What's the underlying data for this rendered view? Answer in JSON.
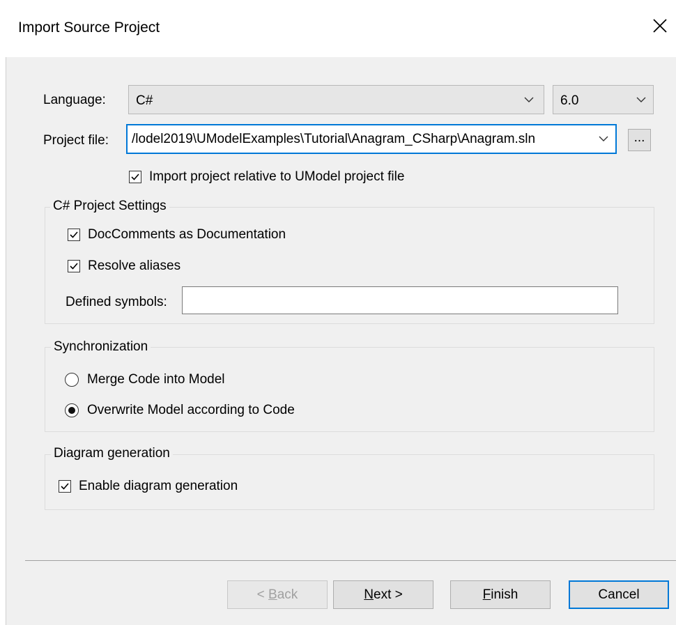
{
  "dialog": {
    "title": "Import Source Project",
    "close_icon": "close-icon"
  },
  "language": {
    "label": "Language:",
    "value": "C#",
    "version": "6.0"
  },
  "project_file": {
    "label": "Project file:",
    "value": "/lodel2019\\UModelExamples\\Tutorial\\Anagram_CSharp\\Anagram.sln",
    "browse_label": "..."
  },
  "import_relative": {
    "label": "Import project relative to UModel project file",
    "checked": true
  },
  "csharp_settings": {
    "title": "C# Project Settings",
    "doc_comments": {
      "label": "DocComments as Documentation",
      "checked": true
    },
    "resolve_aliases": {
      "label": "Resolve aliases",
      "checked": true
    },
    "defined_symbols": {
      "label": "Defined symbols:",
      "value": ""
    }
  },
  "synchronization": {
    "title": "Synchronization",
    "merge": {
      "label": "Merge Code into Model",
      "selected": false
    },
    "overwrite": {
      "label": "Overwrite Model according to Code",
      "selected": true
    }
  },
  "diagram_generation": {
    "title": "Diagram generation",
    "enable": {
      "label": "Enable diagram generation",
      "checked": true
    }
  },
  "footer": {
    "back": {
      "prefix": "< ",
      "mnemonic": "B",
      "rest": "ack",
      "enabled": false
    },
    "next": {
      "mnemonic": "N",
      "rest": "ext >"
    },
    "finish": {
      "mnemonic": "F",
      "rest": "inish"
    },
    "cancel": "Cancel"
  },
  "colors": {
    "accent": "#0078d7",
    "dialog_bg": "#f0f0f0",
    "disabled_text": "#a0a0a0"
  }
}
